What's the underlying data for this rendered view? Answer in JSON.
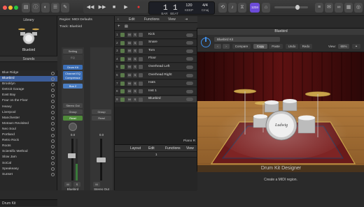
{
  "toolbar": {
    "transport": {
      "rewind": "◀◀",
      "forward": "▶▶",
      "stop": "■",
      "play": "▶",
      "record": "●",
      "cycle": "⟲"
    },
    "lcd": {
      "bar": "1",
      "beat": "1",
      "tempo": "120",
      "tempo_label": "KEEP",
      "signature": "4/4",
      "key": "Cmaj",
      "bar_label": "BAR",
      "beat_label": "BEAT"
    },
    "user_badge": "1234",
    "accent": "#6c4bd8"
  },
  "library": {
    "title": "Library",
    "patch_name": "Bluebird",
    "sounds_header": "Sounds",
    "items": [
      "Blue Ridge",
      "Bluebird",
      "Brooklyn",
      "Detroit Garage",
      "East Bay",
      "Four on the Floor",
      "Heavy",
      "Liverpool",
      "Manchester",
      "Motown Revisited",
      "Neo Soul",
      "Portland",
      "Retro Rock",
      "Roots",
      "Scientific Method",
      "Slow Jam",
      "SoCal",
      "Speakeasy",
      "Sunset"
    ],
    "selected_index": 1,
    "footer": "Drum Kit"
  },
  "inspector": {
    "region": "Region: MIDI Defaults",
    "track": "Track: Bluebird",
    "setting": "Setting",
    "eq_label": "EQ",
    "strip_name": "Bluebird",
    "plugin1": "Drum Kit",
    "plugin2": "Channel EQ Compressor",
    "send": "Bus 2",
    "stereo_out": "Stereo Out",
    "group": "Group",
    "read1": "Read",
    "read2": "Read",
    "vol1": "0.0",
    "vol2": "0.0",
    "m": "M",
    "s": "S",
    "bottom_name1": "Bluebird",
    "bottom_name2": "Stereo Out"
  },
  "tracks": {
    "menu": {
      "edit": "Edit",
      "functions": "Functions",
      "view": "View"
    },
    "rows": [
      {
        "num": "1",
        "name": "Kick"
      },
      {
        "num": "2",
        "name": "Snare"
      },
      {
        "num": "3",
        "name": "Tom"
      },
      {
        "num": "4",
        "name": "Floor"
      },
      {
        "num": "5",
        "name": "Overhead Left"
      },
      {
        "num": "6",
        "name": "Overhead Right"
      },
      {
        "num": "7",
        "name": "Hats"
      },
      {
        "num": "8",
        "name": "Inst 1"
      },
      {
        "num": "9",
        "name": "Bluebird"
      }
    ],
    "selected_index": 8
  },
  "plugin": {
    "title": "Bluebird",
    "preset": "Bluebird Kit",
    "compare": "Compare",
    "copy": "Copy",
    "paste": "Paste",
    "undo": "Undo",
    "redo": "Redo",
    "view_label": "View:",
    "view_value": "65%",
    "footer": "Drum Kit Designer",
    "kick_brand": "Ludwig"
  },
  "editor": {
    "layout": "Layout",
    "edit": "Edit",
    "functions": "Functions",
    "view": "View",
    "piano_roll_tab": "Piano R",
    "ruler_start": "1"
  },
  "status": "Create a MIDI region."
}
